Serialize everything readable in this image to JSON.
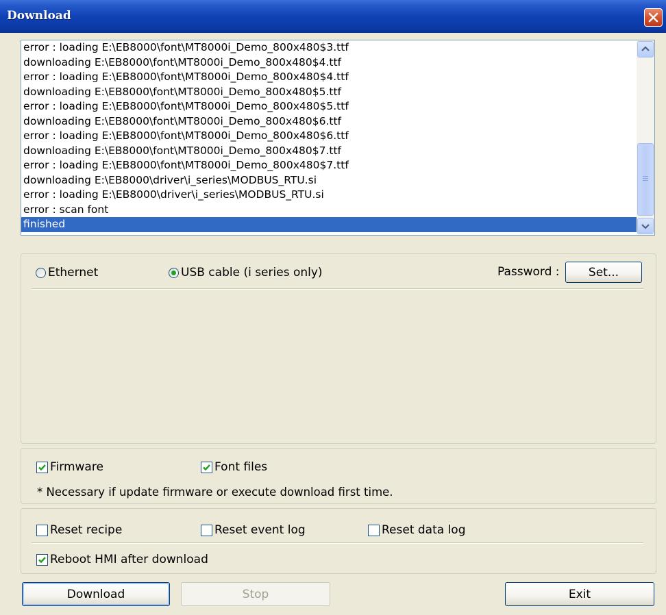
{
  "window": {
    "title": "Download"
  },
  "log": {
    "lines": [
      "error : loading E:\\EB8000\\font\\MT8000i_Demo_800x480$3.ttf",
      "downloading E:\\EB8000\\font\\MT8000i_Demo_800x480$4.ttf",
      "error : loading E:\\EB8000\\font\\MT8000i_Demo_800x480$4.ttf",
      "downloading E:\\EB8000\\font\\MT8000i_Demo_800x480$5.ttf",
      "error : loading E:\\EB8000\\font\\MT8000i_Demo_800x480$5.ttf",
      "downloading E:\\EB8000\\font\\MT8000i_Demo_800x480$6.ttf",
      "error : loading E:\\EB8000\\font\\MT8000i_Demo_800x480$6.ttf",
      "downloading E:\\EB8000\\font\\MT8000i_Demo_800x480$7.ttf",
      "error : loading E:\\EB8000\\font\\MT8000i_Demo_800x480$7.ttf",
      "downloading E:\\EB8000\\driver\\i_series\\MODBUS_RTU.si",
      "error : loading E:\\EB8000\\driver\\i_series\\MODBUS_RTU.si",
      "error : scan font",
      "finished"
    ],
    "selected_index": 12
  },
  "connection": {
    "ethernet_label": "Ethernet",
    "usb_label": "USB cable (i series only)",
    "selected": "usb",
    "password_label": "Password :",
    "set_button": "Set..."
  },
  "files": {
    "firmware_label": "Firmware",
    "firmware_checked": true,
    "font_files_label": "Font files",
    "font_files_checked": true,
    "note": "* Necessary if update firmware or execute download first time."
  },
  "options": {
    "reset_recipe_label": "Reset recipe",
    "reset_recipe_checked": false,
    "reset_event_log_label": "Reset event log",
    "reset_event_log_checked": false,
    "reset_data_log_label": "Reset data log",
    "reset_data_log_checked": false,
    "reboot_label": "Reboot HMI after download",
    "reboot_checked": true
  },
  "buttons": {
    "download": "Download",
    "stop": "Stop",
    "exit": "Exit"
  },
  "colors": {
    "title_bar": "#0f40b3",
    "selection": "#316ac5",
    "check_mark": "#21a121",
    "dialog_bg": "#ece9d8"
  }
}
